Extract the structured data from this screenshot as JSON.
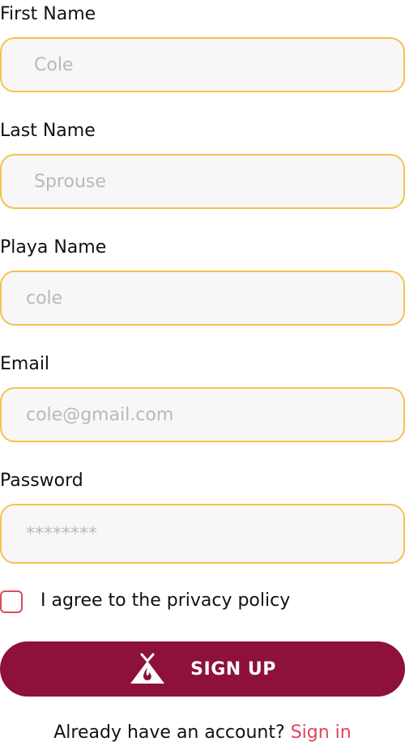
{
  "form": {
    "fields": [
      {
        "label": "First Name",
        "placeholder": "Cole"
      },
      {
        "label": "Last Name",
        "placeholder": "Sprouse"
      },
      {
        "label": "Playa Name",
        "placeholder": "cole"
      },
      {
        "label": "Email",
        "placeholder": "cole@gmail.com"
      },
      {
        "label": "Password",
        "placeholder": "********"
      }
    ],
    "privacy_label": "I agree to the privacy policy",
    "privacy_checked": false
  },
  "signup": {
    "label": "SIGN UP",
    "icon": "campfire-tent-icon"
  },
  "footer": {
    "prompt": "Already have an account?",
    "link": "Sign in"
  },
  "colors": {
    "field_border": "#f5c24f",
    "field_bg": "#f7f7f7",
    "button": "#8e103d",
    "accent": "#e0435a"
  }
}
